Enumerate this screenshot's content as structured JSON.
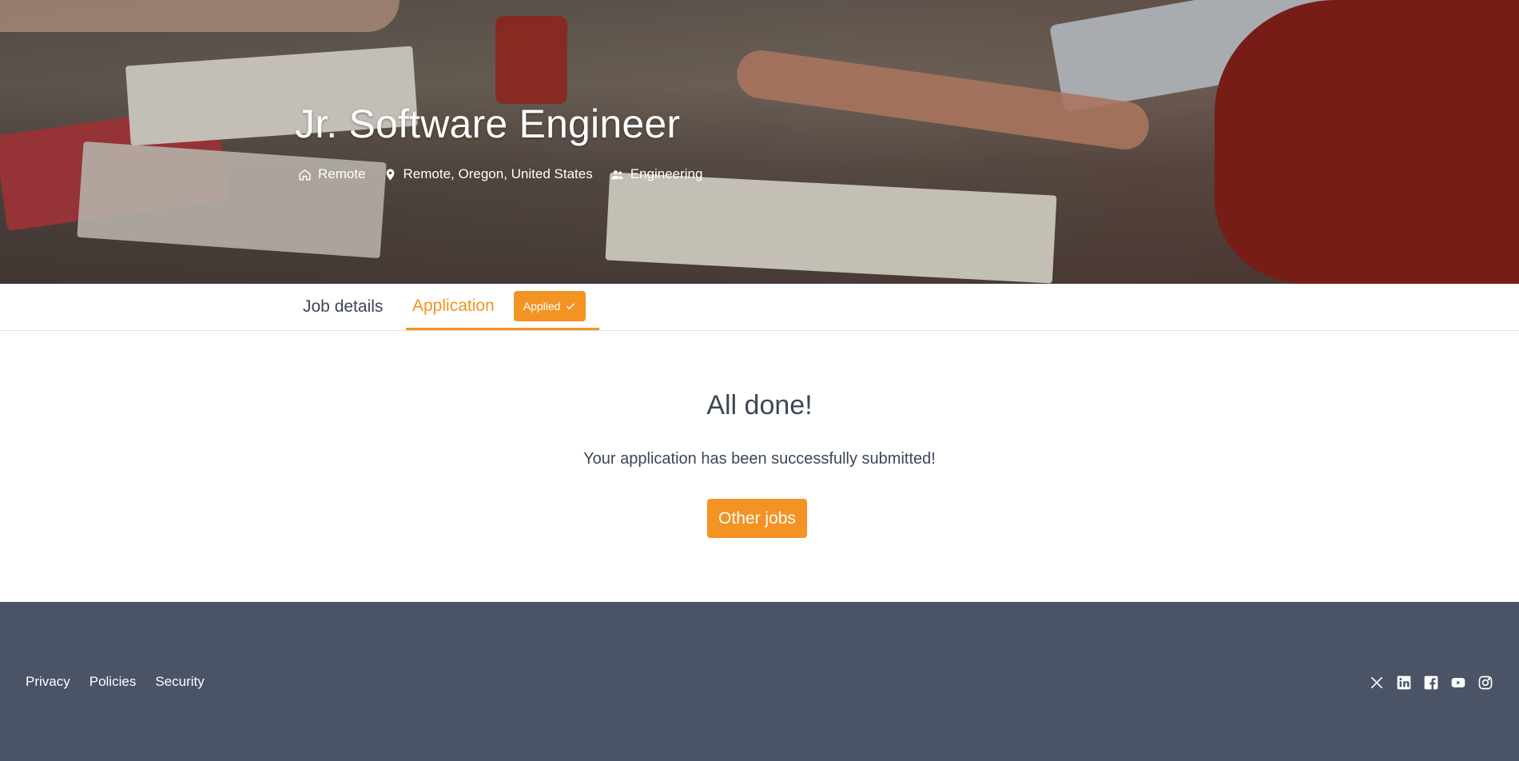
{
  "hero": {
    "title": "Jr. Software Engineer",
    "workplace": "Remote",
    "location": "Remote, Oregon, United States",
    "department": "Engineering",
    "icons": [
      "home-icon",
      "location-pin-icon",
      "people-icon"
    ]
  },
  "tabs": {
    "job_details": "Job details",
    "application": "Application",
    "applied_badge": "Applied"
  },
  "main": {
    "title": "All done!",
    "message": "Your application has been successfully submitted!",
    "button": "Other jobs"
  },
  "footer": {
    "links": [
      "Privacy",
      "Policies",
      "Security"
    ],
    "social": [
      "x-icon",
      "linkedin-icon",
      "facebook-icon",
      "youtube-icon",
      "instagram-icon"
    ]
  },
  "colors": {
    "accent": "#f39323",
    "footer_bg": "#4a5466",
    "text": "#3c4656"
  }
}
